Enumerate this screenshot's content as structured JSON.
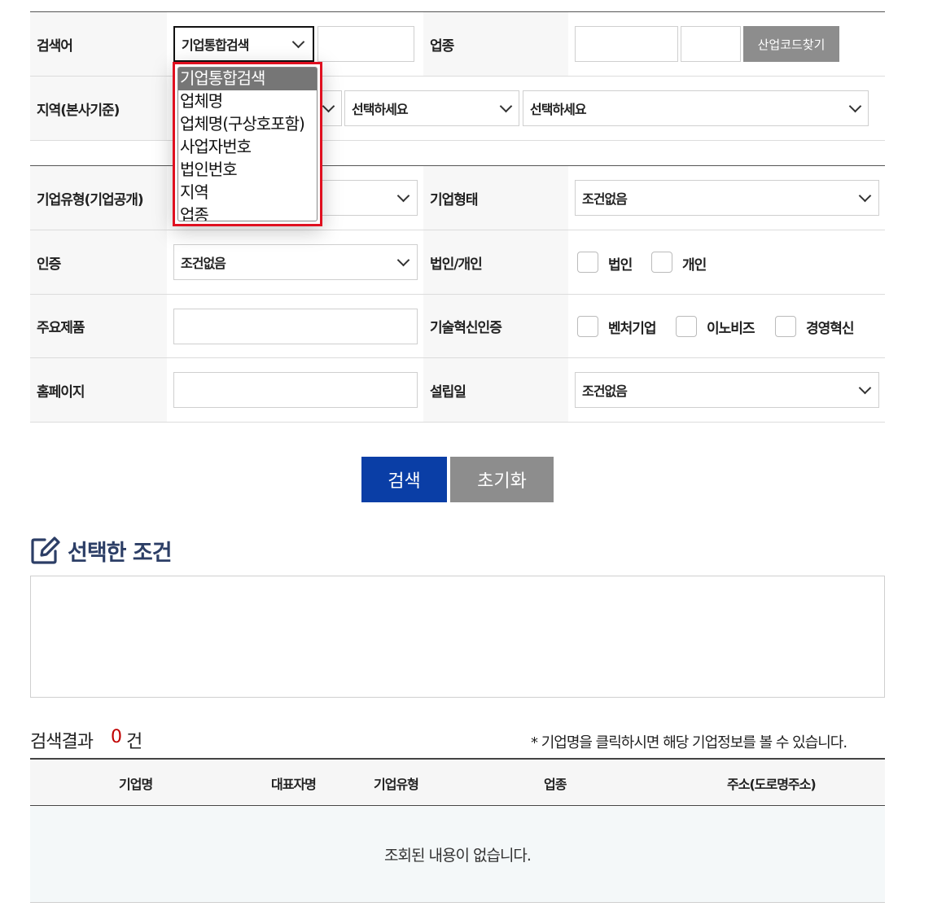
{
  "form": {
    "keyword": {
      "label": "검색어",
      "select_value": "기업통합검색",
      "input_value": ""
    },
    "industry": {
      "label": "업종",
      "button": "산업코드찾기"
    },
    "region": {
      "label": "지역(본사기준)",
      "select2": "선택하세요",
      "select3": "선택하세요"
    },
    "company_type": {
      "label": "기업유형(기업공개)"
    },
    "company_form": {
      "label": "기업형태",
      "value": "조건없음"
    },
    "cert": {
      "label": "인증",
      "value": "조건없음"
    },
    "corp_indiv": {
      "label": "법인/개인",
      "options": [
        "법인",
        "개인"
      ]
    },
    "product": {
      "label": "주요제품",
      "value": ""
    },
    "tech_cert": {
      "label": "기술혁신인증",
      "options": [
        "벤처기업",
        "이노비즈",
        "경영혁신"
      ]
    },
    "homepage": {
      "label": "홈페이지",
      "value": ""
    },
    "founded": {
      "label": "설립일",
      "value": "조건없음"
    }
  },
  "dropdown": {
    "options": [
      "기업통합검색",
      "업체명",
      "업체명(구상호포함)",
      "사업자번호",
      "법인번호",
      "지역",
      "업종"
    ],
    "selected_index": 0
  },
  "buttons": {
    "search": "검색",
    "reset": "초기화"
  },
  "selected_conditions": {
    "title": "선택한 조건"
  },
  "results": {
    "label": "검색결과",
    "count": "0",
    "unit": "건",
    "note": "*  기업명을 클릭하시면 해당 기업정보를 볼 수 있습니다.",
    "columns": [
      "기업명",
      "대표자명",
      "기업유형",
      "업종",
      "주소(도로명주소)"
    ],
    "empty": "조회된 내용이 없습니다."
  },
  "colors": {
    "accent": "#0a3ea6",
    "highlight": "#e01020",
    "count": "#c00000"
  }
}
